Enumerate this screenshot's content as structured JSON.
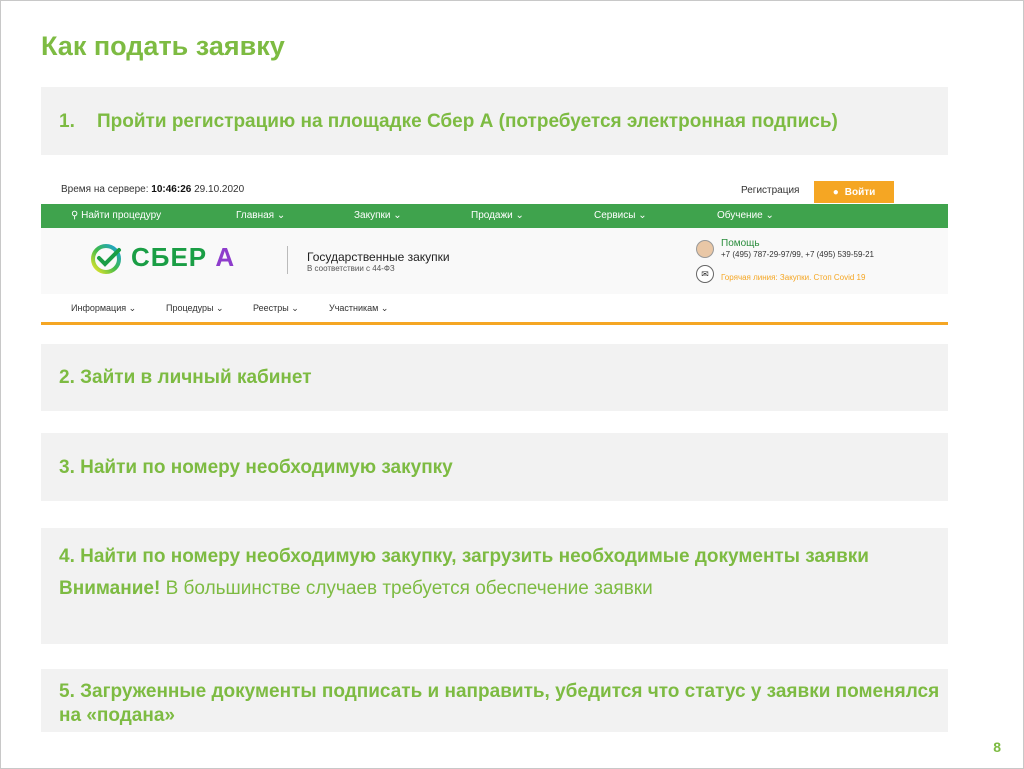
{
  "title": "Как подать заявку",
  "steps": {
    "s1_num": "1.",
    "s1_text": "Пройти регистрацию на площадке Сбер А (потребуется электронная подпись)",
    "s2": "2. Зайти в личный кабинет",
    "s3": "3. Найти по номеру необходимую закупку",
    "s4": "4. Найти по номеру необходимую закупку, загрузить необходимые документы заявки",
    "s4_warn_bold": "Внимание!",
    "s4_warn_text": " В большинстве случаев требуется обеспечение заявки",
    "s5": "5. Загруженные документы подписать и направить, убедится что статус у заявки поменялся на «подана»"
  },
  "page_number": "8",
  "site": {
    "server_label": "Время на сервере: ",
    "server_time": "10:46:26",
    "server_date": " 29.10.2020",
    "register": "Регистрация",
    "login": "Войти",
    "nav": {
      "search": "Найти процедуру",
      "main": "Главная",
      "purchases": "Закупки",
      "sales": "Продажи",
      "services": "Сервисы",
      "learning": "Обучение"
    },
    "brand_main": "СБЕР",
    "brand_suffix": "А",
    "gos_title": "Государственные закупки",
    "gos_sub": "В соответствии с 44-ФЗ",
    "help": "Помощь",
    "phones": "+7 (495) 787-29-97/99, +7 (495) 539-59-21",
    "hotline": "Горячая линия: Закупки. Стоп Covid 19",
    "submenu": {
      "info": "Информация",
      "procedures": "Процедуры",
      "registries": "Реестры",
      "participants": "Участникам"
    }
  },
  "colors": {
    "accent_green": "#7dbb42",
    "nav_green": "#3fa34d",
    "orange": "#f5a623"
  }
}
